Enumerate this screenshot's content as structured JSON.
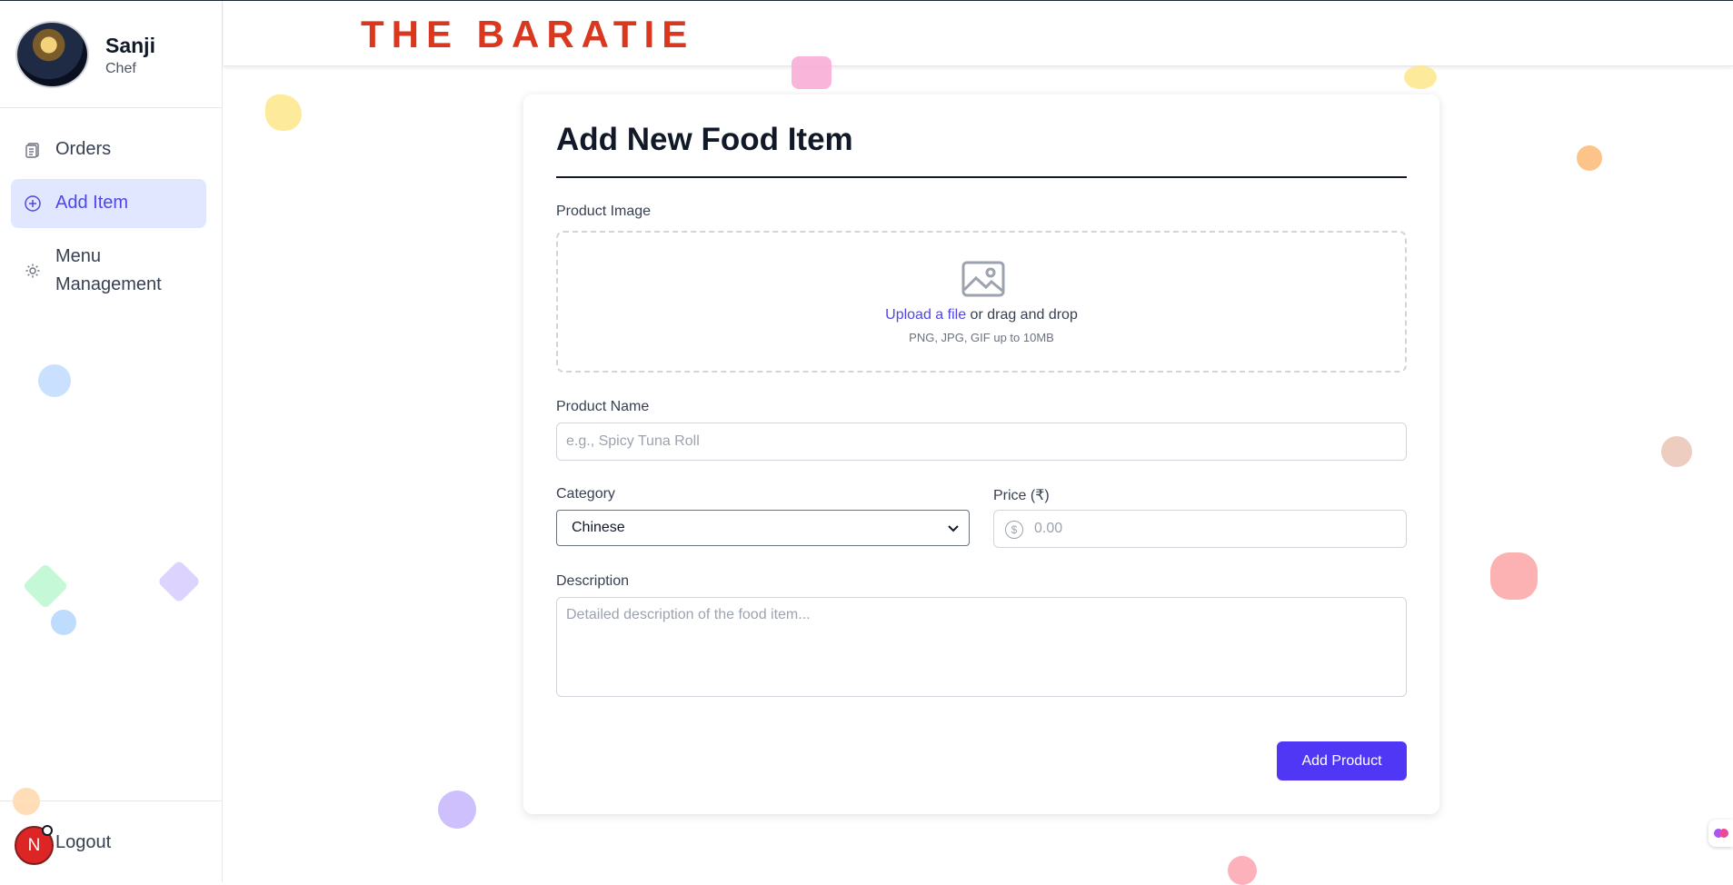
{
  "brand": {
    "title": "THE BARATIE",
    "color": "#d9381e"
  },
  "profile": {
    "name": "Sanji",
    "role": "Chef"
  },
  "sidebar": {
    "items": [
      {
        "label": "Orders",
        "icon": "clipboard-icon",
        "active": false
      },
      {
        "label": "Add Item",
        "icon": "plus-circle-icon",
        "active": true
      },
      {
        "label": "Menu Management",
        "icon": "gear-icon",
        "active": false
      }
    ],
    "logout": {
      "label": "Logout",
      "badge": "N"
    }
  },
  "form": {
    "title": "Add New Food Item",
    "image_label": "Product Image",
    "upload_link": "Upload a file",
    "upload_rest": " or drag and drop",
    "upload_hint": "PNG, JPG, GIF up to 10MB",
    "name_label": "Product Name",
    "name_placeholder": "e.g., Spicy Tuna Roll",
    "category_label": "Category",
    "category_value": "Chinese",
    "price_label": "Price (₹)",
    "price_placeholder": "0.00",
    "price_icon": "$",
    "description_label": "Description",
    "description_placeholder": "Detailed description of the food item...",
    "submit_label": "Add Product"
  },
  "colors": {
    "accent": "#4f37f5",
    "active_bg": "#e0e7ff",
    "active_text": "#4f46e5"
  }
}
